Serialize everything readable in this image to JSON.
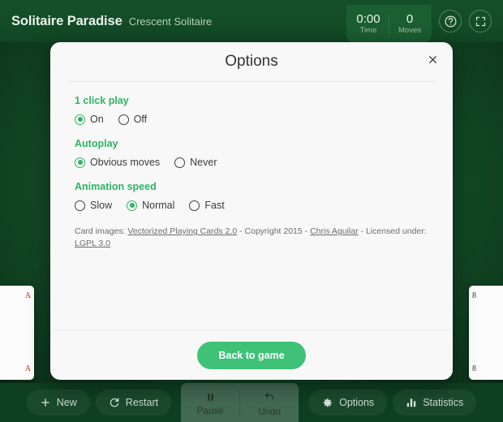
{
  "header": {
    "brand_title": "Solitaire Paradise",
    "brand_subtitle": "Crescent Solitaire",
    "time_value": "0:00",
    "time_label": "Time",
    "moves_value": "0",
    "moves_label": "Moves",
    "help_icon": "help-circle-icon",
    "fullscreen_icon": "fullscreen-icon"
  },
  "modal": {
    "title": "Options",
    "close_icon": "close-icon",
    "groups": [
      {
        "label": "1 click play",
        "options": [
          {
            "label": "On",
            "selected": true
          },
          {
            "label": "Off",
            "selected": false
          }
        ]
      },
      {
        "label": "Autoplay",
        "options": [
          {
            "label": "Obvious moves",
            "selected": true
          },
          {
            "label": "Never",
            "selected": false
          }
        ]
      },
      {
        "label": "Animation speed",
        "options": [
          {
            "label": "Slow",
            "selected": false
          },
          {
            "label": "Normal",
            "selected": true
          },
          {
            "label": "Fast",
            "selected": false
          }
        ]
      }
    ],
    "credits": {
      "prefix": "Card images: ",
      "link_cards": "Vectorized Playing Cards 2.0",
      "mid1": " - Copyright 2015 - ",
      "link_author": "Chris Aguilar",
      "mid2": " - Licensed under: ",
      "link_license": "LGPL 3.0"
    },
    "back_button": "Back to game"
  },
  "toolbar": {
    "new_label": "New",
    "new_icon": "plus-icon",
    "restart_label": "Restart",
    "restart_icon": "refresh-icon",
    "pause_label": "Pause",
    "pause_icon": "pause-icon",
    "undo_label": "Undo",
    "undo_icon": "undo-arrow-icon",
    "options_label": "Options",
    "options_icon": "gear-icon",
    "statistics_label": "Statistics",
    "statistics_icon": "bar-chart-icon"
  },
  "colors": {
    "accent_green": "#2fb464",
    "button_green": "#3fc277",
    "board_green": "#134a26",
    "header_green": "#13502a",
    "modal_bg": "#f8f8f8"
  }
}
